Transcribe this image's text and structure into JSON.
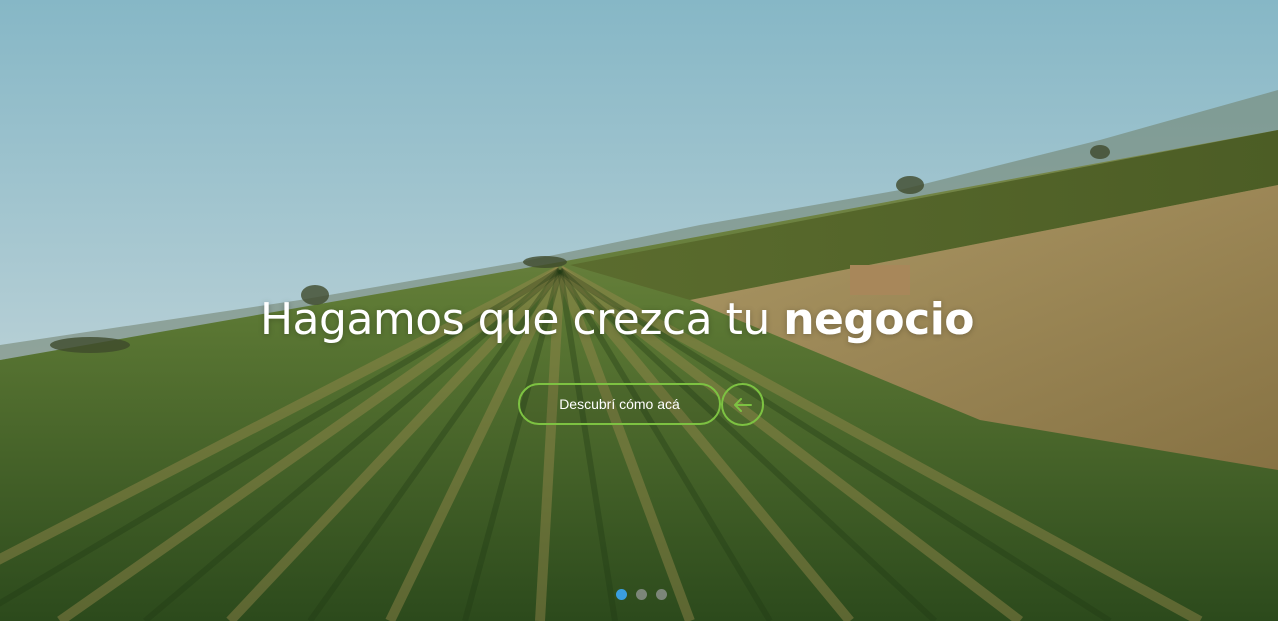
{
  "hero": {
    "headline_regular": "Hagamos que crezca tu",
    "headline_bold": "negocio",
    "cta_label": "Descubrí cómo acá",
    "arrow_icon": "arrow-left-icon",
    "accent_color": "#7dc242"
  },
  "carousel": {
    "slide_count": 3,
    "active_index": 0,
    "active_color": "#3a9ee0"
  }
}
